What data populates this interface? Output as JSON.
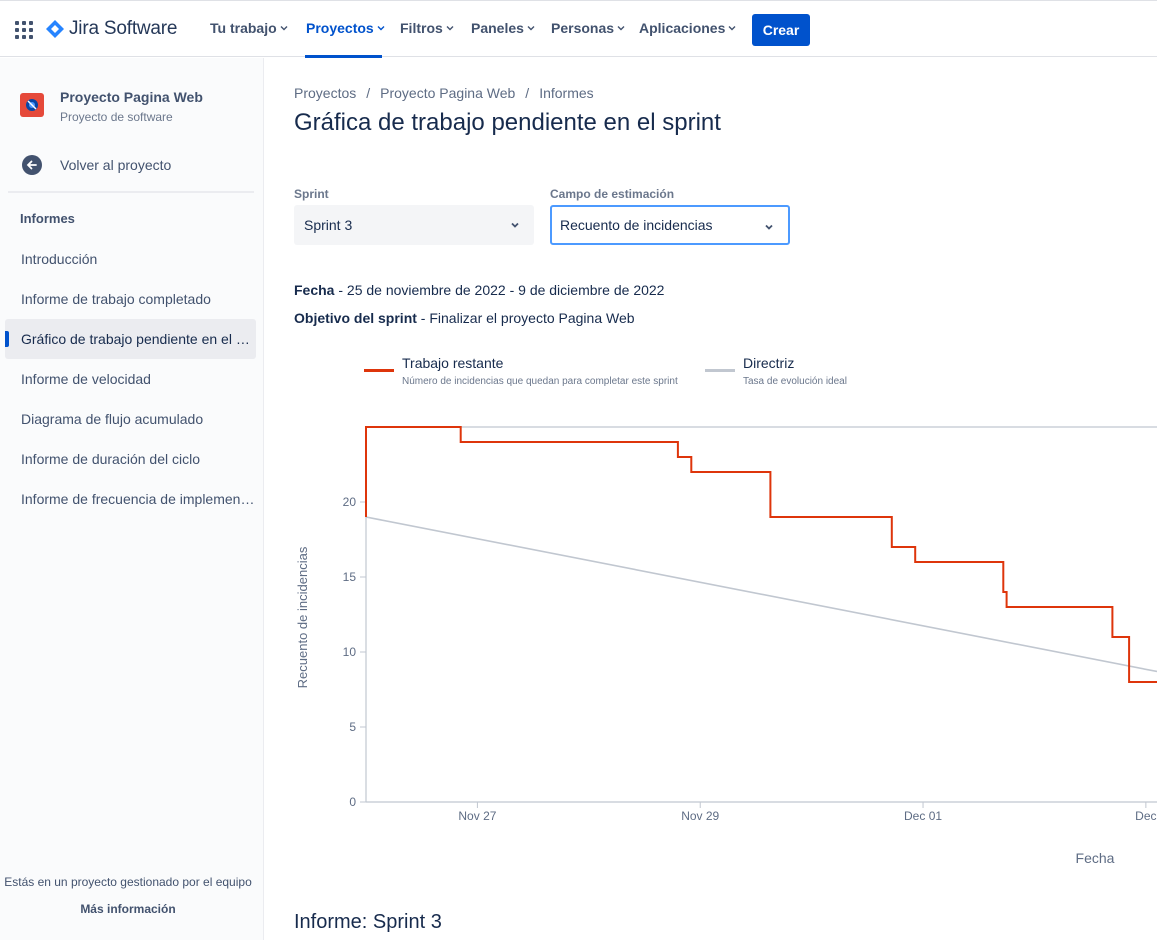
{
  "nav": {
    "brand": "Jira Software",
    "items": [
      "Tu trabajo",
      "Proyectos",
      "Filtros",
      "Paneles",
      "Personas",
      "Aplicaciones"
    ],
    "active": "Proyectos",
    "create": "Crear"
  },
  "sidebar": {
    "project_name": "Proyecto Pagina Web",
    "project_type": "Proyecto de software",
    "back": "Volver al proyecto",
    "heading": "Informes",
    "items": [
      "Introducción",
      "Informe de trabajo completado",
      "Gráfico de trabajo pendiente en el sprint",
      "Informe de velocidad",
      "Diagrama de flujo acumulado",
      "Informe de duración del ciclo",
      "Informe de frecuencia de implementación"
    ],
    "active_index": 2,
    "footer_text": "Estás en un proyecto gestionado por el equipo",
    "footer_link": "Más información"
  },
  "breadcrumb": [
    "Proyectos",
    "Proyecto Pagina Web",
    "Informes"
  ],
  "page_title": "Gráfica de trabajo pendiente en el sprint",
  "filters": {
    "sprint_label": "Sprint",
    "sprint_value": "Sprint 3",
    "campo_label": "Campo de estimación",
    "campo_value": "Recuento de incidencias"
  },
  "info": {
    "fecha_label": "Fecha",
    "fecha_value": " - 25 de noviembre de 2022 - 9 de diciembre de 2022",
    "objetivo_label": "Objetivo del sprint",
    "objetivo_value": " - Finalizar el proyecto Pagina Web"
  },
  "legend": [
    {
      "title": "Trabajo restante",
      "sub": "Número de incidencias que quedan para completar este sprint",
      "color": "#DE350B"
    },
    {
      "title": "Directriz",
      "sub": "Tasa de evolución ideal",
      "color": "#C1C7D0"
    }
  ],
  "chart_data": {
    "type": "line",
    "xlabel": "Fecha",
    "ylabel": "Recuento de incidencias",
    "ylim": [
      0,
      25
    ],
    "yticks": [
      0,
      5,
      10,
      15,
      20
    ],
    "xticks": [
      {
        "label": "Nov 27",
        "day": 27.0
      },
      {
        "label": "Nov 29",
        "day": 29.0
      },
      {
        "label": "Dec 01",
        "day": 31.0
      },
      {
        "label": "Dec",
        "day": 33.0
      }
    ],
    "xlim_days": [
      26.0,
      33.1
    ],
    "series": [
      {
        "name": "Trabajo restante",
        "color": "#DE350B",
        "step": true,
        "points": [
          [
            26.0,
            19
          ],
          [
            26.0,
            25
          ],
          [
            26.85,
            25
          ],
          [
            26.85,
            24
          ],
          [
            28.8,
            24
          ],
          [
            28.8,
            23
          ],
          [
            28.92,
            23
          ],
          [
            28.92,
            22
          ],
          [
            29.63,
            22
          ],
          [
            29.63,
            19
          ],
          [
            30.72,
            19
          ],
          [
            30.72,
            17
          ],
          [
            30.93,
            17
          ],
          [
            30.93,
            16
          ],
          [
            31.72,
            16
          ],
          [
            31.72,
            14
          ],
          [
            31.75,
            14
          ],
          [
            31.75,
            13
          ],
          [
            32.7,
            13
          ],
          [
            32.7,
            11
          ],
          [
            32.85,
            11
          ],
          [
            32.85,
            8
          ],
          [
            33.1,
            8
          ]
        ]
      },
      {
        "name": "Directriz",
        "color": "#C1C7D0",
        "step": false,
        "points": [
          [
            26.0,
            19
          ],
          [
            33.1,
            8.7
          ]
        ]
      }
    ]
  },
  "report_title": "Informe: Sprint 3"
}
